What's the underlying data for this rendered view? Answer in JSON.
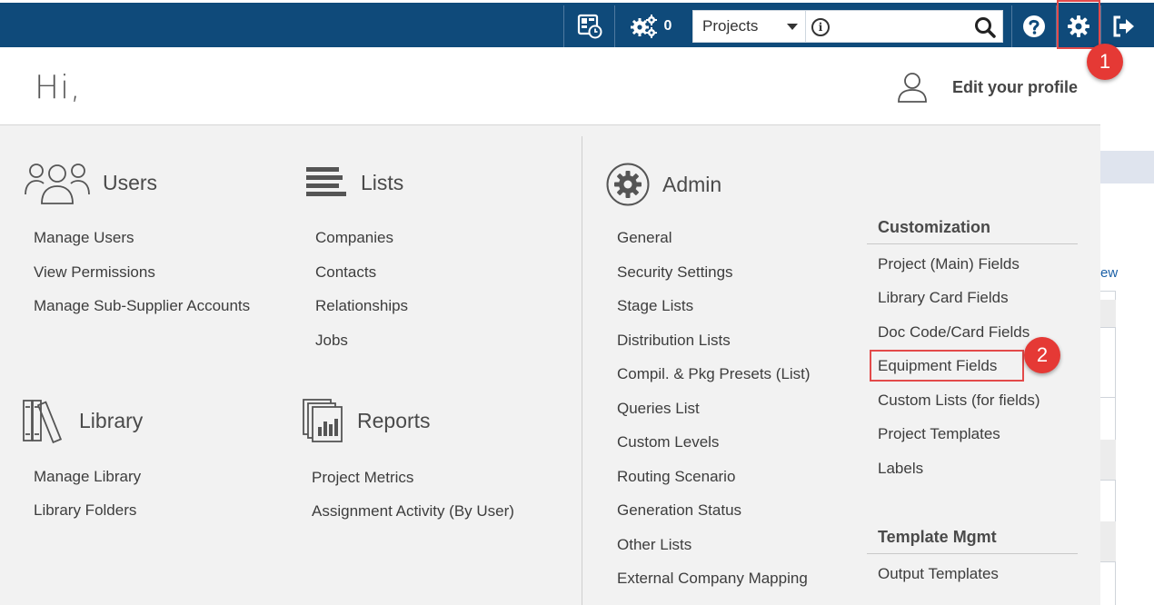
{
  "topbar": {
    "notification_count": "0",
    "search": {
      "scope": "Projects",
      "placeholder": ""
    },
    "colors": {
      "bar": "#0f4a7a",
      "highlight": "#e34a4a",
      "callout": "#e53935"
    }
  },
  "callouts": {
    "first": "1",
    "second": "2"
  },
  "greeting": {
    "text": "Hi,",
    "edit_profile": "Edit your profile"
  },
  "sections": {
    "users": {
      "title": "Users",
      "items": [
        "Manage Users",
        "View Permissions",
        "Manage Sub-Supplier Accounts"
      ]
    },
    "lists": {
      "title": "Lists",
      "items": [
        "Companies",
        "Contacts",
        "Relationships",
        "Jobs"
      ]
    },
    "library": {
      "title": "Library",
      "items": [
        "Manage Library",
        "Library Folders"
      ]
    },
    "reports": {
      "title": "Reports",
      "items": [
        "Project Metrics",
        "Assignment Activity (By User)"
      ]
    },
    "admin": {
      "title": "Admin",
      "items": [
        "General",
        "Security Settings",
        "Stage Lists",
        "Distribution Lists",
        "Compil. & Pkg Presets (List)",
        "Queries List",
        "Custom Levels",
        "Routing Scenario",
        "Generation Status",
        "Other Lists",
        "External Company Mapping"
      ],
      "customization": {
        "title": "Customization",
        "items": [
          "Project (Main) Fields",
          "Library Card Fields",
          "Doc Code/Card Fields",
          "Equipment Fields",
          "Custom Lists (for fields)",
          "Project Templates",
          "Labels"
        ]
      },
      "template_mgmt": {
        "title": "Template Mgmt",
        "items": [
          "Output Templates"
        ]
      }
    }
  },
  "background": {
    "link_fragment": "ew"
  }
}
